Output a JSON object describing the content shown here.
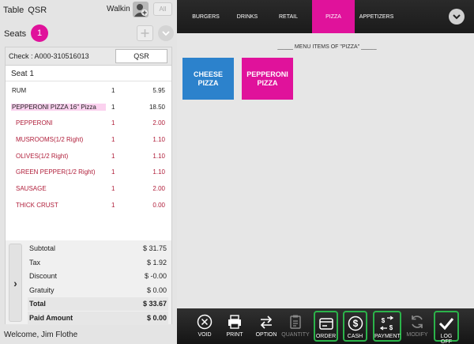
{
  "header": {
    "table_label": "Table",
    "order_type": "QSR",
    "customer": "Walkin",
    "all_label": "All"
  },
  "seats": {
    "label": "Seats",
    "count": "1"
  },
  "check": {
    "label": "Check : A000-310516013",
    "type_button": "QSR",
    "seat_label": "Seat 1",
    "items": [
      {
        "name": "RUM",
        "qty": "1",
        "amount": "5.95"
      },
      {
        "name": "PEPPERONI PIZZA 16\" Pizza",
        "qty": "1",
        "amount": "18.50"
      },
      {
        "name": "PEPPERONI",
        "qty": "1",
        "amount": "2.00"
      },
      {
        "name": "MUSROOMS(1/2 Right)",
        "qty": "1",
        "amount": "1.10"
      },
      {
        "name": "OLIVES(1/2 Right)",
        "qty": "1",
        "amount": "1.10"
      },
      {
        "name": "GREEN PEPPER(1/2 Right)",
        "qty": "1",
        "amount": "1.10"
      },
      {
        "name": "SAUSAGE",
        "qty": "1",
        "amount": "2.00"
      },
      {
        "name": "THICK CRUST",
        "qty": "1",
        "amount": "0.00"
      }
    ]
  },
  "totals": {
    "subtotal_label": "Subtotal",
    "subtotal": "$ 31.75",
    "tax_label": "Tax",
    "tax": "$ 1.92",
    "discount_label": "Discount",
    "discount": "$ -0.00",
    "gratuity_label": "Gratuity",
    "gratuity": "$ 0.00",
    "total_label": "Total",
    "total": "$ 33.67",
    "paid_label": "Paid Amount",
    "paid": "$ 0.00"
  },
  "footer": {
    "welcome": "Welcome, Jim Flothe"
  },
  "tabs": [
    "BURGERS",
    "DRINKS",
    "RETAIL",
    "PIZZA",
    "APPETIZERS"
  ],
  "active_tab": "PIZZA",
  "menu": {
    "title": "_____ MENU ITEMS OF \"PIZZA\" _____",
    "items": [
      "CHEESE PIZZA",
      "PEPPERONI PIZZA"
    ]
  },
  "toolbar": {
    "void": "VOID",
    "print": "PRINT",
    "option": "OPTION",
    "quantity": "QUANTITY",
    "order": "ORDER",
    "cash": "CASH",
    "payment": "PAYMENT",
    "modify": "MODIFY",
    "logoff": "LOG OFF"
  },
  "colors": {
    "accent": "#e0129b",
    "menu_blue": "#2c82cc",
    "modifier_text": "#b01e3a",
    "highlight_frame": "#2bb34a"
  }
}
